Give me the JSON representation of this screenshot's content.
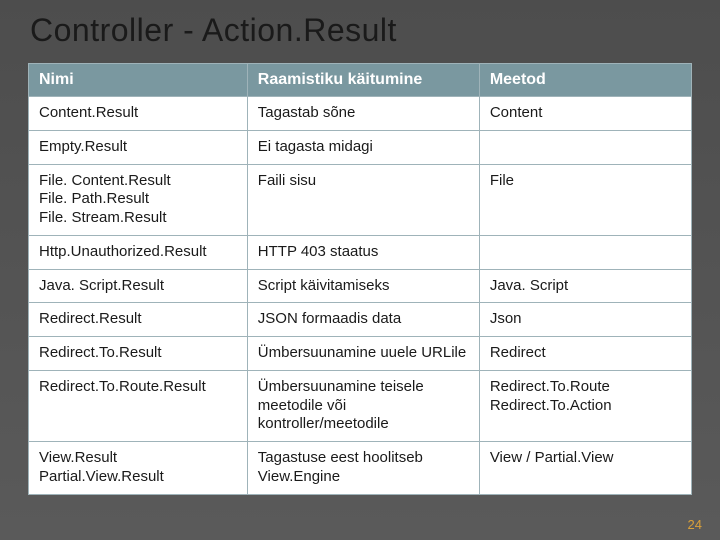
{
  "title": "Controller - Action.Result",
  "page_number": "24",
  "table": {
    "headers": [
      "Nimi",
      "Raamistiku käitumine",
      "Meetod"
    ],
    "rows": [
      {
        "c1": "Content.Result",
        "c2": "Tagastab sõne",
        "c3": "Content"
      },
      {
        "c1": "Empty.Result",
        "c2": "Ei tagasta midagi",
        "c3": ""
      },
      {
        "c1": "File. Content.Result\nFile. Path.Result\nFile. Stream.Result",
        "c2": "Faili sisu",
        "c3": "File"
      },
      {
        "c1": "Http.Unauthorized.Result",
        "c2": "HTTP 403 staatus",
        "c3": ""
      },
      {
        "c1": "Java. Script.Result",
        "c2": "Script käivitamiseks",
        "c3": "Java. Script"
      },
      {
        "c1": "Redirect.Result",
        "c2": "JSON formaadis data",
        "c3": "Json"
      },
      {
        "c1": "Redirect.To.Result",
        "c2": "Ümbersuunamine uuele URLile",
        "c3": "Redirect"
      },
      {
        "c1": "Redirect.To.Route.Result",
        "c2": "Ümbersuunamine teisele meetodile või kontroller/meetodile",
        "c3": "Redirect.To.Route\nRedirect.To.Action"
      },
      {
        "c1": "View.Result\nPartial.View.Result",
        "c2": "Tagastuse eest hoolitseb View.Engine",
        "c3": "View / Partial.View"
      }
    ]
  }
}
